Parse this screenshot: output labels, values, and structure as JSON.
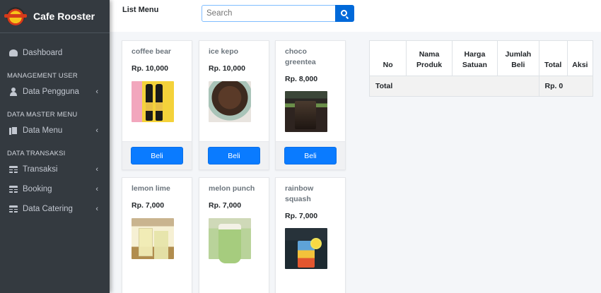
{
  "app": {
    "brand": "Cafe Rooster"
  },
  "sidebar": {
    "dashboard": "Dashboard",
    "sections": [
      {
        "header": "MANAGEMENT USER",
        "items": [
          {
            "label": "Data Pengguna",
            "icon": "user-icon"
          }
        ]
      },
      {
        "header": "DATA MASTER MENU",
        "items": [
          {
            "label": "Data Menu",
            "icon": "copy-icon"
          }
        ]
      },
      {
        "header": "DATA TRANSAKSI",
        "items": [
          {
            "label": "Transaksi",
            "icon": "table-icon"
          },
          {
            "label": "Booking",
            "icon": "table-icon"
          },
          {
            "label": "Data Catering",
            "icon": "table-icon"
          }
        ]
      }
    ],
    "chevron": "‹"
  },
  "header": {
    "title": "List Menu",
    "search_placeholder": "Search"
  },
  "products": [
    {
      "name": "coffee bear",
      "price": "Rp. 10,000",
      "button": "Beli"
    },
    {
      "name": "ice kepo",
      "price": "Rp. 10,000",
      "button": "Beli"
    },
    {
      "name": "choco greentea",
      "price": "Rp. 8,000",
      "button": "Beli"
    },
    {
      "name": "lemon lime",
      "price": "Rp. 7,000",
      "button": "Beli"
    },
    {
      "name": "melon punch",
      "price": "Rp. 7,000",
      "button": "Beli"
    },
    {
      "name": "rainbow squash",
      "price": "Rp. 7,000",
      "button": "Beli"
    }
  ],
  "cart": {
    "columns": [
      "No",
      "Nama Produk",
      "Harga Satuan",
      "Jumlah Beli",
      "Total",
      "Aksi"
    ],
    "total_label": "Total",
    "total_value": "Rp. 0"
  },
  "colors": {
    "sidebar": "#343a40",
    "primary": "#007bff",
    "background": "#f4f6f9"
  }
}
